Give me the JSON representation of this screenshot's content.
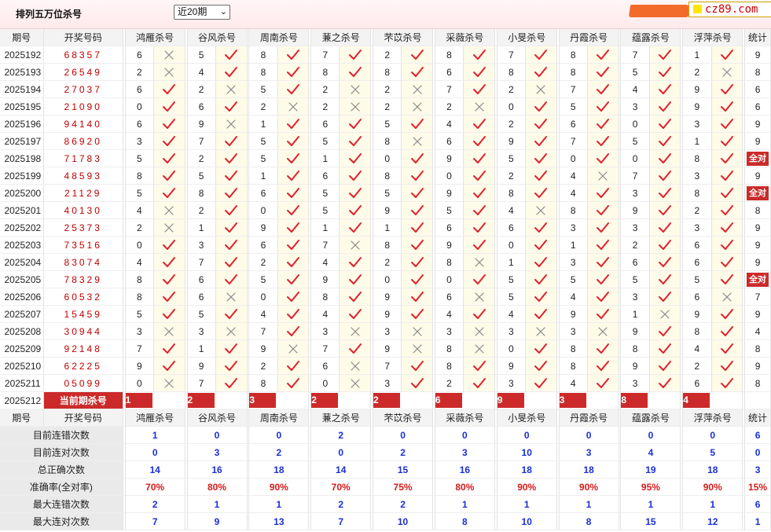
{
  "header": {
    "title": "排列五万位杀号",
    "period_select": "近20期",
    "logo_text": "cz89.com"
  },
  "columns": {
    "period": "期号",
    "draw": "开奖号码",
    "total": "统计",
    "experts": [
      "鸿雁杀号",
      "谷风杀号",
      "周南杀号",
      "蒹之杀号",
      "芣苡杀号",
      "采薇杀号",
      "小旻杀号",
      "丹霞杀号",
      "蕴露杀号",
      "浮萍杀号"
    ]
  },
  "rows": [
    {
      "period": "2025192",
      "draw": "68357",
      "kills": [
        6,
        5,
        8,
        7,
        2,
        8,
        7,
        8,
        7,
        1
      ],
      "hits": [
        0,
        1,
        1,
        1,
        1,
        1,
        1,
        1,
        1,
        1
      ],
      "total": "9"
    },
    {
      "period": "2025193",
      "draw": "26549",
      "kills": [
        2,
        4,
        8,
        8,
        8,
        6,
        8,
        8,
        5,
        2
      ],
      "hits": [
        0,
        1,
        1,
        1,
        1,
        1,
        1,
        1,
        1,
        0
      ],
      "total": "8"
    },
    {
      "period": "2025194",
      "draw": "27037",
      "kills": [
        6,
        2,
        5,
        2,
        2,
        7,
        2,
        7,
        4,
        9
      ],
      "hits": [
        1,
        0,
        1,
        0,
        0,
        1,
        0,
        1,
        1,
        1
      ],
      "total": "6"
    },
    {
      "period": "2025195",
      "draw": "21090",
      "kills": [
        0,
        6,
        2,
        2,
        2,
        2,
        0,
        5,
        3,
        9
      ],
      "hits": [
        1,
        1,
        0,
        0,
        0,
        0,
        1,
        1,
        1,
        1
      ],
      "total": "6"
    },
    {
      "period": "2025196",
      "draw": "94140",
      "kills": [
        6,
        9,
        1,
        6,
        5,
        4,
        2,
        6,
        0,
        3
      ],
      "hits": [
        1,
        0,
        1,
        1,
        1,
        1,
        1,
        1,
        1,
        1
      ],
      "total": "9"
    },
    {
      "period": "2025197",
      "draw": "86920",
      "kills": [
        3,
        7,
        5,
        5,
        8,
        6,
        9,
        7,
        5,
        1
      ],
      "hits": [
        1,
        1,
        1,
        1,
        0,
        1,
        1,
        1,
        1,
        1
      ],
      "total": "9"
    },
    {
      "period": "2025198",
      "draw": "71783",
      "kills": [
        5,
        2,
        5,
        1,
        0,
        9,
        5,
        0,
        0,
        8
      ],
      "hits": [
        1,
        1,
        1,
        1,
        1,
        1,
        1,
        1,
        1,
        1
      ],
      "total": "全对"
    },
    {
      "period": "2025199",
      "draw": "48593",
      "kills": [
        8,
        5,
        1,
        6,
        8,
        0,
        2,
        4,
        7,
        3
      ],
      "hits": [
        1,
        1,
        1,
        1,
        1,
        1,
        1,
        0,
        1,
        1
      ],
      "total": "9"
    },
    {
      "period": "2025200",
      "draw": "21129",
      "kills": [
        5,
        8,
        6,
        5,
        5,
        9,
        8,
        4,
        3,
        8
      ],
      "hits": [
        1,
        1,
        1,
        1,
        1,
        1,
        1,
        1,
        1,
        1
      ],
      "total": "全对"
    },
    {
      "period": "2025201",
      "draw": "40130",
      "kills": [
        4,
        2,
        0,
        5,
        9,
        5,
        4,
        8,
        9,
        2
      ],
      "hits": [
        0,
        1,
        1,
        1,
        1,
        1,
        0,
        1,
        1,
        1
      ],
      "total": "8"
    },
    {
      "period": "2025202",
      "draw": "25373",
      "kills": [
        2,
        1,
        9,
        1,
        1,
        6,
        6,
        3,
        3,
        3
      ],
      "hits": [
        0,
        1,
        1,
        1,
        1,
        1,
        1,
        1,
        1,
        1
      ],
      "total": "9"
    },
    {
      "period": "2025203",
      "draw": "73516",
      "kills": [
        0,
        3,
        6,
        7,
        8,
        9,
        0,
        1,
        2,
        6
      ],
      "hits": [
        1,
        1,
        1,
        0,
        1,
        1,
        1,
        1,
        1,
        1
      ],
      "total": "9"
    },
    {
      "period": "2025204",
      "draw": "83074",
      "kills": [
        4,
        7,
        2,
        4,
        2,
        8,
        1,
        3,
        6,
        6
      ],
      "hits": [
        1,
        1,
        1,
        1,
        1,
        0,
        1,
        1,
        1,
        1
      ],
      "total": "9"
    },
    {
      "period": "2025205",
      "draw": "78329",
      "kills": [
        8,
        6,
        5,
        9,
        0,
        0,
        5,
        5,
        5,
        5
      ],
      "hits": [
        1,
        1,
        1,
        1,
        1,
        1,
        1,
        1,
        1,
        1
      ],
      "total": "全对"
    },
    {
      "period": "2025206",
      "draw": "60532",
      "kills": [
        8,
        6,
        0,
        8,
        9,
        6,
        5,
        4,
        3,
        6
      ],
      "hits": [
        1,
        0,
        1,
        1,
        1,
        0,
        1,
        1,
        1,
        0
      ],
      "total": "7"
    },
    {
      "period": "2025207",
      "draw": "15459",
      "kills": [
        5,
        5,
        4,
        4,
        9,
        4,
        4,
        9,
        1,
        9
      ],
      "hits": [
        1,
        1,
        1,
        1,
        1,
        1,
        1,
        1,
        0,
        1
      ],
      "total": "9"
    },
    {
      "period": "2025208",
      "draw": "30944",
      "kills": [
        3,
        3,
        7,
        3,
        3,
        3,
        3,
        3,
        9,
        8
      ],
      "hits": [
        0,
        0,
        1,
        0,
        0,
        0,
        0,
        0,
        1,
        1
      ],
      "total": "4"
    },
    {
      "period": "2025209",
      "draw": "92148",
      "kills": [
        7,
        1,
        9,
        7,
        9,
        8,
        0,
        8,
        8,
        4
      ],
      "hits": [
        1,
        1,
        0,
        1,
        0,
        0,
        1,
        1,
        1,
        1
      ],
      "total": "8"
    },
    {
      "period": "2025210",
      "draw": "62225",
      "kills": [
        9,
        9,
        2,
        6,
        7,
        8,
        9,
        8,
        9,
        2
      ],
      "hits": [
        1,
        1,
        1,
        0,
        1,
        1,
        1,
        1,
        1,
        1
      ],
      "total": "9"
    },
    {
      "period": "2025211",
      "draw": "05099",
      "kills": [
        0,
        7,
        8,
        0,
        3,
        2,
        3,
        4,
        3,
        6
      ],
      "hits": [
        0,
        1,
        1,
        0,
        1,
        1,
        1,
        1,
        1,
        1
      ],
      "total": "8"
    }
  ],
  "current": {
    "period": "2025212",
    "label": "当前期杀号",
    "kills": [
      "1",
      "2",
      "3",
      "2",
      "2",
      "6",
      "9",
      "3",
      "8",
      "4"
    ]
  },
  "stats": {
    "labels": [
      "目前连错次数",
      "目前连对次数",
      "总正确次数",
      "准确率(全对率)",
      "最大连错次数",
      "最大连对次数"
    ],
    "rows": [
      [
        "1",
        "0",
        "0",
        "2",
        "0",
        "0",
        "0",
        "0",
        "0",
        "0",
        "6"
      ],
      [
        "0",
        "3",
        "2",
        "0",
        "2",
        "3",
        "10",
        "3",
        "4",
        "5",
        "0"
      ],
      [
        "14",
        "16",
        "18",
        "14",
        "15",
        "16",
        "18",
        "18",
        "19",
        "18",
        "3"
      ],
      [
        "70%",
        "80%",
        "90%",
        "70%",
        "75%",
        "80%",
        "90%",
        "90%",
        "95%",
        "90%",
        "15%"
      ],
      [
        "2",
        "1",
        "1",
        "2",
        "2",
        "1",
        "1",
        "1",
        "1",
        "1",
        "6"
      ],
      [
        "7",
        "9",
        "13",
        "7",
        "10",
        "8",
        "10",
        "8",
        "15",
        "12",
        "1"
      ]
    ]
  },
  "colors": {
    "hit": "#e0202c",
    "miss": "#888888",
    "accent": "#cc2a2a",
    "stat_blue": "#1a2fd8",
    "stat_red": "#d81a1a"
  }
}
